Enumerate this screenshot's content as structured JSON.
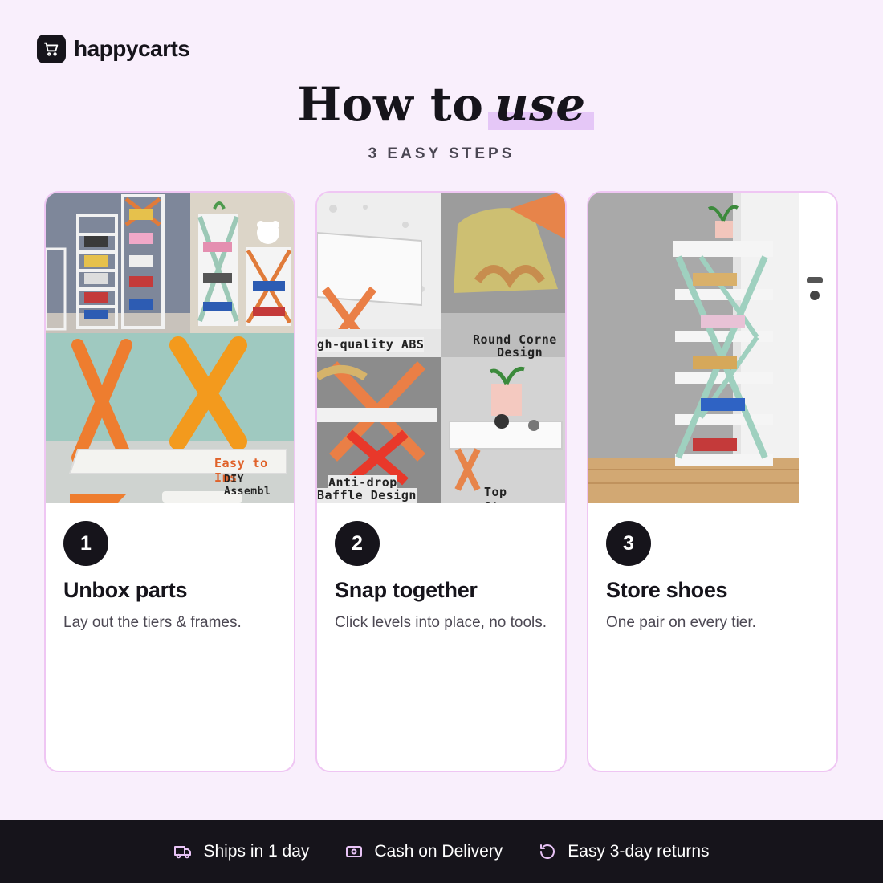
{
  "brand": {
    "name": "happycarts",
    "logo_icon": "cart-icon"
  },
  "heading": {
    "main": "How to",
    "accent": "use"
  },
  "subtitle": "3 EASY STEPS",
  "steps": [
    {
      "number": "1",
      "title": "Unbox parts",
      "description": "Lay out the tiers & frames.",
      "photo_labels": [
        "Easy to Ins",
        "DIY Assembl"
      ]
    },
    {
      "number": "2",
      "title": "Snap together",
      "description": "Click levels into place, no tools.",
      "photo_labels": [
        "gh-quality ABS",
        "Round Corne",
        "Design",
        "Anti-drop",
        "Baffle Design",
        "Top Storage"
      ]
    },
    {
      "number": "3",
      "title": "Store shoes",
      "description": "One pair on every tier.",
      "photo_labels": []
    }
  ],
  "footer": [
    {
      "label": "Ships in 1 day",
      "icon": "truck-icon"
    },
    {
      "label": "Cash on Delivery",
      "icon": "cash-icon"
    },
    {
      "label": "Easy 3-day returns",
      "icon": "return-icon"
    }
  ],
  "colors": {
    "background": "#f9effc",
    "dark": "#16141b",
    "accent_highlight": "#e5c7f7",
    "card_border": "#efc6f3",
    "step_number_text": "#ffffff"
  }
}
